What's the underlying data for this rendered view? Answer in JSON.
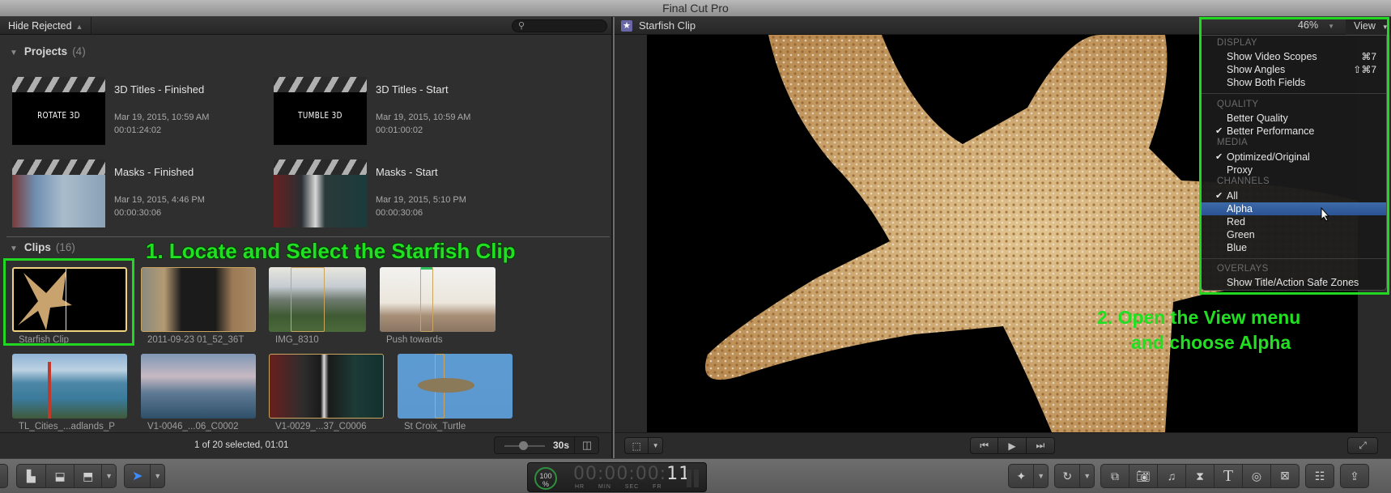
{
  "window": {
    "title": "Final Cut Pro"
  },
  "browser": {
    "filter_label": "Hide Rejected",
    "search_placeholder": "",
    "projects_section": {
      "label": "Projects",
      "count": "(4)"
    },
    "projects": [
      {
        "title": "3D Titles - Finished",
        "thumb_text": "ROTATE 3D",
        "date": "Mar 19, 2015, 10:59 AM",
        "duration": "00:01:24:02"
      },
      {
        "title": "3D Titles - Start",
        "thumb_text": "TUMBLE 3D",
        "date": "Mar 19, 2015, 10:59 AM",
        "duration": "00:01:00:02"
      },
      {
        "title": "Masks - Finished",
        "thumb_text": "",
        "date": "Mar 19, 2015, 4:46 PM",
        "duration": "00:00:30:06"
      },
      {
        "title": "Masks - Start",
        "thumb_text": "",
        "date": "Mar 19, 2015, 5:10 PM",
        "duration": "00:00:30:06"
      }
    ],
    "clips_section": {
      "label": "Clips",
      "count": "(16)"
    },
    "clips": [
      {
        "name": "Starfish Clip",
        "selected": true
      },
      {
        "name": "2011-09-23 01_52_36T",
        "selected": false
      },
      {
        "name": "IMG_8310",
        "selected": false
      },
      {
        "name": "Push towards",
        "selected": false
      },
      {
        "name": "TL_Cities_...adlands_P",
        "selected": false
      },
      {
        "name": "V1-0046_...06_C0002",
        "selected": false
      },
      {
        "name": "V1-0029_...37_C0006",
        "selected": false
      },
      {
        "name": "St Croix_Turtle",
        "selected": false
      }
    ],
    "status": "1 of 20 selected, 01:01",
    "zoom_label": "30s"
  },
  "viewer": {
    "clip_title": "Starfish Clip",
    "zoom_percent": "46%",
    "view_menu_label": "View"
  },
  "view_menu": {
    "sections": [
      {
        "header": "DISPLAY",
        "items": [
          {
            "label": "Show Video Scopes",
            "shortcut": "⌘7",
            "checked": false
          },
          {
            "label": "Show Angles",
            "shortcut": "⇧⌘7",
            "checked": false
          },
          {
            "label": "Show Both Fields",
            "shortcut": "",
            "checked": false
          }
        ]
      },
      {
        "header": "QUALITY",
        "items": [
          {
            "label": "Better Quality",
            "checked": false
          },
          {
            "label": "Better Performance",
            "checked": true
          }
        ]
      },
      {
        "header": "MEDIA",
        "items": [
          {
            "label": "Optimized/Original",
            "checked": true
          },
          {
            "label": "Proxy",
            "checked": false
          }
        ]
      },
      {
        "header": "CHANNELS",
        "items": [
          {
            "label": "All",
            "checked": true
          },
          {
            "label": "Alpha",
            "checked": false,
            "highlighted": true
          },
          {
            "label": "Red",
            "checked": false
          },
          {
            "label": "Green",
            "checked": false
          },
          {
            "label": "Blue",
            "checked": false
          }
        ]
      },
      {
        "header": "OVERLAYS",
        "items": [
          {
            "label": "Show Title/Action Safe Zones",
            "checked": false
          }
        ]
      }
    ],
    "check_glyph": "✔"
  },
  "annotations": {
    "step1": "1. Locate and Select the Starfish Clip",
    "step2_line1": "2. Open the View menu",
    "step2_line2": "and choose Alpha",
    "color": "#21e021"
  },
  "timecode": {
    "percent": "100",
    "percent_sign": "%",
    "dim": "00:00:00:",
    "frames": "11",
    "labels": "HR MIN SEC FR"
  },
  "colors": {
    "accent_highlight": "#2f5a9e",
    "selection_border": "#f1d37f",
    "annotation_green": "#21d721"
  }
}
